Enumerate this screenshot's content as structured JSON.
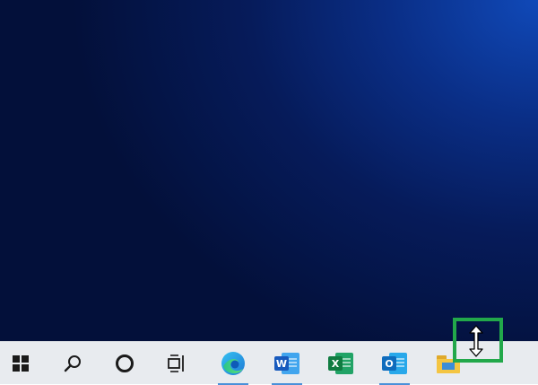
{
  "desktop": {
    "wallpaper": "windows-blue-gradient"
  },
  "taskbar": {
    "items": [
      {
        "name": "start",
        "icon": "windows-logo-icon"
      },
      {
        "name": "search",
        "icon": "search-icon"
      },
      {
        "name": "cortana",
        "icon": "cortana-ring-icon"
      },
      {
        "name": "task-view",
        "icon": "task-view-icon"
      },
      {
        "name": "edge",
        "icon": "edge-icon",
        "running": true
      },
      {
        "name": "word",
        "icon": "word-icon",
        "letter": "W",
        "running": true
      },
      {
        "name": "excel",
        "icon": "excel-icon",
        "letter": "X",
        "running": false
      },
      {
        "name": "outlook",
        "icon": "outlook-icon",
        "letter": "O",
        "running": true
      },
      {
        "name": "file-explorer",
        "icon": "folder-icon"
      }
    ],
    "running_indicator_color": "#4a90d9"
  },
  "cursor": {
    "type": "vertical-resize",
    "highlight_color": "#22a84a"
  }
}
